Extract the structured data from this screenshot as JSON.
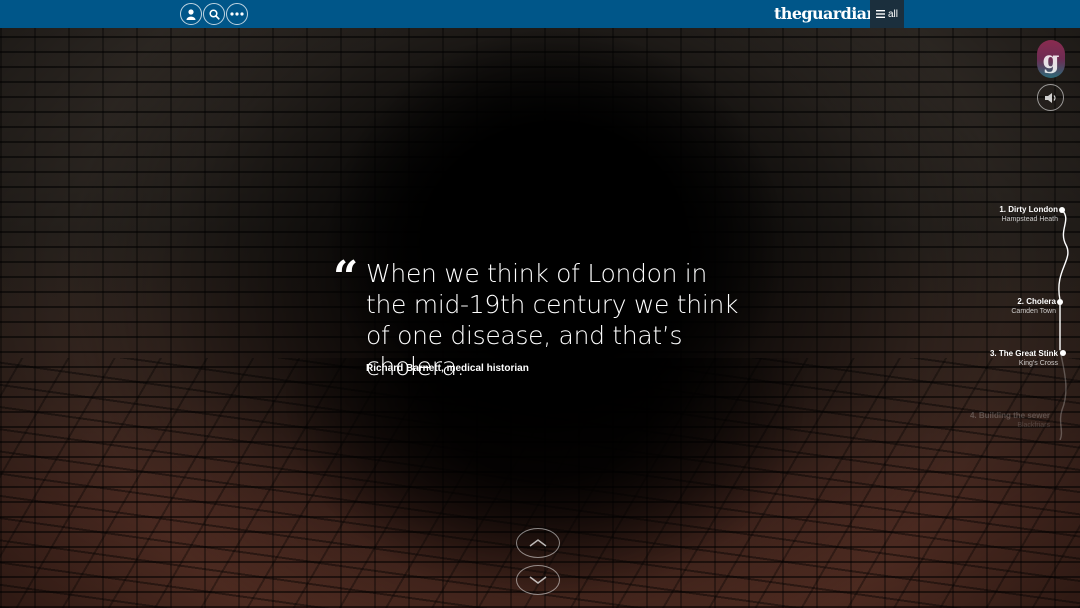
{
  "header": {
    "brand": "theguardian",
    "menu_label": "all",
    "icons": [
      "user-icon",
      "search-icon",
      "more-icon"
    ]
  },
  "colors": {
    "topbar": "#005689",
    "menu_button": "#1b2f3d",
    "text": "#ffffff"
  },
  "quote": {
    "text": "When we think of London in the mid-19th century we think of one disease, and that’s cholera.",
    "attribution": "Richard Barnett, medical historian"
  },
  "chapters": [
    {
      "title": "1. Dirty London",
      "subtitle": "Hampstead Heath"
    },
    {
      "title": "2. Cholera",
      "subtitle": "Camden Town"
    },
    {
      "title": "3. The Great Stink",
      "subtitle": "King's Cross"
    },
    {
      "title": "4. Building the sewer",
      "subtitle": "Blackfriars"
    }
  ],
  "controls": {
    "logo_letter": "g",
    "sound": "speaker-icon",
    "prev": "chevron-up-icon",
    "next": "chevron-down-icon"
  }
}
